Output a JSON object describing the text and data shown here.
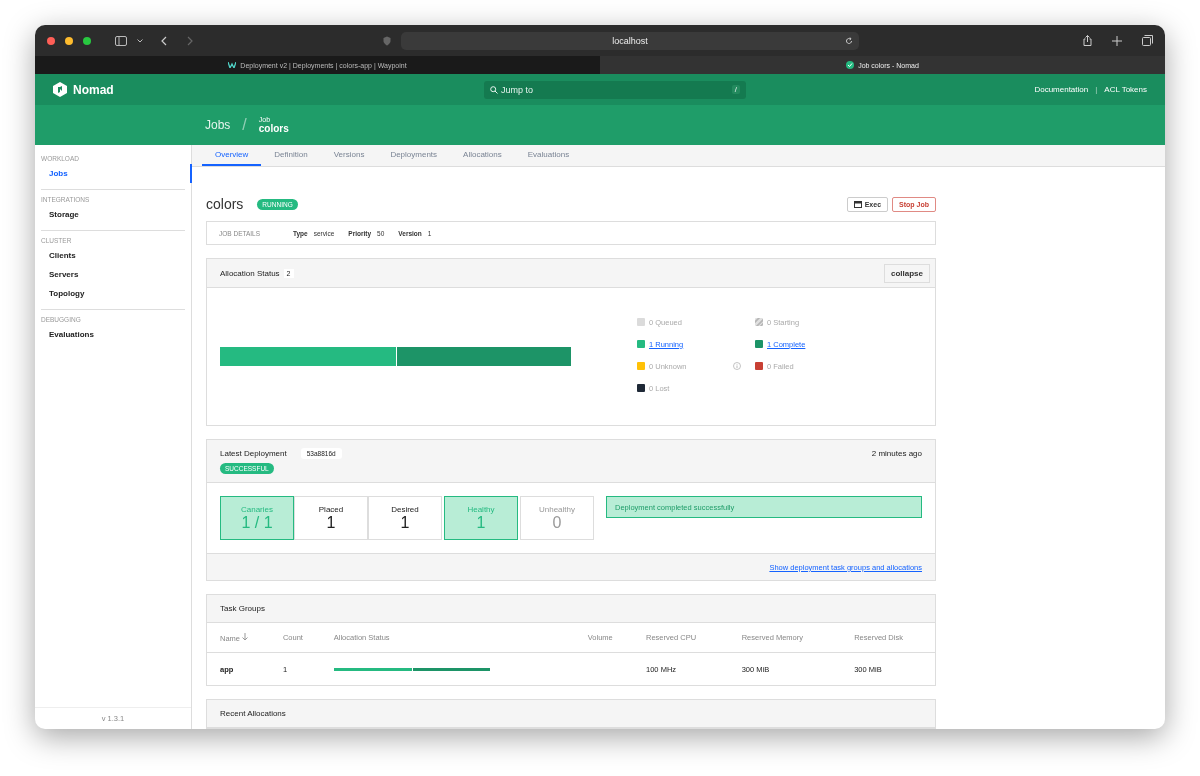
{
  "browser": {
    "url": "localhost",
    "tabs": [
      {
        "label": "Deployment v2 | Deployments | colors-app | Waypoint",
        "selected": false
      },
      {
        "label": "Job colors - Nomad",
        "selected": true
      }
    ]
  },
  "header": {
    "brand": "Nomad",
    "search": {
      "placeholder": "Jump to",
      "shortcut": "/"
    },
    "links": [
      "Documentation",
      "ACL Tokens"
    ],
    "link_separator": "|"
  },
  "breadcrumb_separator": "/",
  "breadcrumbs": [
    {
      "label": "Jobs"
    },
    {
      "small": "Job",
      "label": "colors"
    }
  ],
  "sidebar": {
    "sections": [
      {
        "heading": "WORKLOAD",
        "items": [
          {
            "label": "Jobs",
            "selected": true
          }
        ]
      },
      {
        "heading": "INTEGRATIONS",
        "items": [
          {
            "label": "Storage",
            "selected": false
          }
        ]
      },
      {
        "heading": "CLUSTER",
        "items": [
          {
            "label": "Clients",
            "selected": false
          },
          {
            "label": "Servers",
            "selected": false
          },
          {
            "label": "Topology",
            "selected": false
          }
        ]
      },
      {
        "heading": "DEBUGGING",
        "items": [
          {
            "label": "Evaluations",
            "selected": false
          }
        ]
      }
    ],
    "version": "v 1.3.1"
  },
  "tabs": [
    {
      "label": "Overview",
      "selected": true
    },
    {
      "label": "Definition",
      "selected": false
    },
    {
      "label": "Versions",
      "selected": false
    },
    {
      "label": "Deployments",
      "selected": false
    },
    {
      "label": "Allocations",
      "selected": false
    },
    {
      "label": "Evaluations",
      "selected": false
    }
  ],
  "job": {
    "name": "colors",
    "status": "RUNNING",
    "actions": [
      {
        "kind": "exec",
        "label": "Exec"
      },
      {
        "kind": "danger",
        "label": "Stop Job"
      }
    ],
    "details": {
      "heading": "JOB DETAILS",
      "pairs": [
        {
          "key": "Type",
          "value": "service"
        },
        {
          "key": "Priority",
          "value": "50"
        },
        {
          "key": "Version",
          "value": "1"
        }
      ]
    }
  },
  "allocation_status": {
    "title": "Allocation Status",
    "count": "2",
    "toggle": "collapse",
    "bar": [
      {
        "level": 0.5,
        "color": "#25ba81"
      },
      {
        "level": 0.5,
        "color": "#1d9467"
      }
    ],
    "legend": [
      {
        "label": "0 Queued",
        "color": "#dbdbdb",
        "kind": "plain",
        "link": false
      },
      {
        "label": "0 Starting",
        "color": "#b5b5b5",
        "kind": "hatched",
        "link": false
      },
      {
        "label": "1 Running",
        "color": "#25ba81",
        "kind": "plain",
        "link": true
      },
      {
        "label": "1 Complete",
        "color": "#1d9467",
        "kind": "plain",
        "link": true
      },
      {
        "label": "0 Unknown",
        "color": "#ffc107",
        "kind": "info",
        "link": false
      },
      {
        "label": "0 Failed",
        "color": "#c84034",
        "kind": "plain",
        "link": false
      },
      {
        "label": "0 Lost",
        "color": "#1f2937",
        "kind": "plain",
        "link": false
      }
    ]
  },
  "latest_deployment": {
    "title": "Latest Deployment",
    "id": "53a8816d",
    "status": "SUCCESSFUL",
    "time": "2 minutes ago",
    "metrics": [
      {
        "label": "Canaries",
        "value": "1 / 1",
        "kind": "success"
      },
      {
        "label": "Placed",
        "value": "1",
        "kind": "normal"
      },
      {
        "label": "Desired",
        "value": "1",
        "kind": "normal"
      },
      {
        "label": "Healthy",
        "value": "1",
        "kind": "success"
      },
      {
        "label": "Unhealthy",
        "value": "0",
        "kind": "muted"
      }
    ],
    "notice": "Deployment completed successfully",
    "link": "Show deployment task groups and allocations"
  },
  "task_groups": {
    "title": "Task Groups",
    "columns": [
      "Name",
      "Count",
      "Allocation Status",
      "Volume",
      "Reserved CPU",
      "Reserved Memory",
      "Reserved Disk"
    ],
    "rows": [
      {
        "name": "app",
        "count": "1",
        "bar": [
          {
            "level": 0.5,
            "color": "#25ba81"
          },
          {
            "level": 0.5,
            "color": "#1d9467"
          }
        ],
        "cpu": "100 MHz",
        "memory": "300 MiB",
        "disk": "300 MiB"
      }
    ]
  },
  "recent_allocations": {
    "title": "Recent Allocations"
  }
}
